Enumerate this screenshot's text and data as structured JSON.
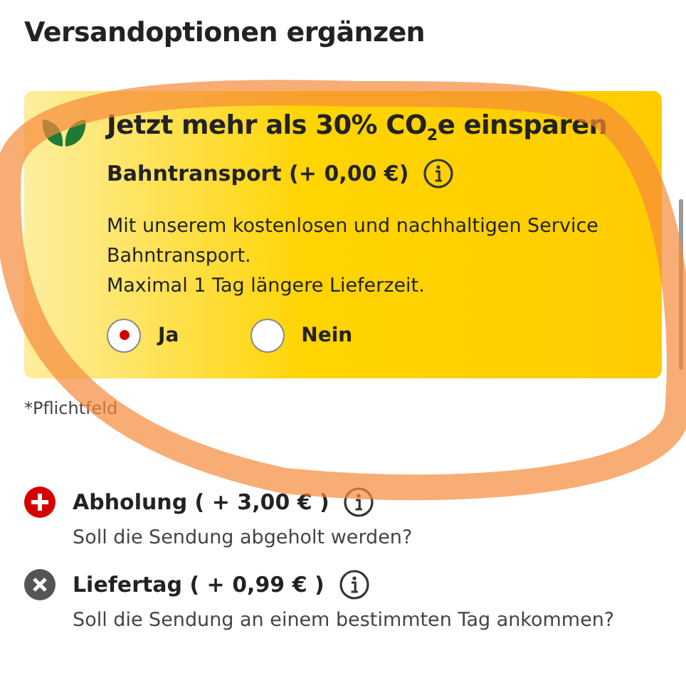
{
  "title": "Versandoptionen ergänzen",
  "promo": {
    "headline": "Jetzt mehr als 30% CO$_{2}$e einsparen",
    "option": "Bahntransport (+ 0,00 €)",
    "description": [
      "Mit unserem kostenlosen und nachhaltigen Service Bahntransport.",
      "Maximal 1 Tag längere Lieferzeit."
    ],
    "choices": [
      {
        "label": "Ja",
        "selected": true
      },
      {
        "label": "Nein",
        "selected": false
      }
    ]
  },
  "required_note": "*Pflichtfeld",
  "options": [
    {
      "kind": "add",
      "label": "Abholung ( + 3,00 € )",
      "question": "Soll die Sendung abgeholt werden?"
    },
    {
      "kind": "remove",
      "label": "Liefertag ( + 0,99 € )",
      "question": "Soll die Sendung an einem bestimmten Tag ankommen?"
    }
  ]
}
